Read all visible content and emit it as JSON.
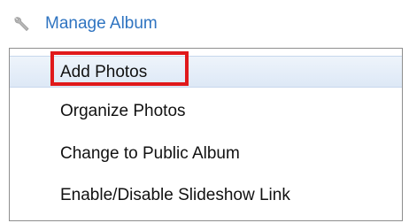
{
  "header": {
    "title": "Manage Album",
    "icon": "wrench-icon",
    "title_color": "#2f74c1"
  },
  "menu": {
    "items": [
      {
        "label": "Add Photos",
        "state": "hover-highlighted"
      },
      {
        "label": "Organize Photos"
      },
      {
        "label": "Change to Public Album"
      },
      {
        "label": "Enable/Disable Slideshow Link"
      }
    ]
  },
  "colors": {
    "highlight_outline": "#e0191b",
    "hover_background": "#e3ecf8",
    "menu_border": "#8e8e8e"
  }
}
